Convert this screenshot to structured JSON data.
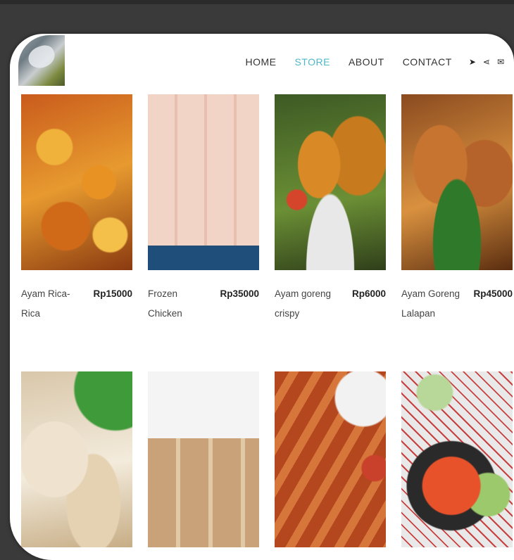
{
  "nav": {
    "items": [
      {
        "label": "HOME",
        "active": false
      },
      {
        "label": "STORE",
        "active": true
      },
      {
        "label": "ABOUT",
        "active": false
      },
      {
        "label": "CONTACT",
        "active": false
      }
    ],
    "icons": [
      "location-arrow-icon",
      "share-icon",
      "envelope-icon"
    ],
    "accent_color": "#4fb8c8"
  },
  "products": [
    {
      "name": "Ayam Rica-Rica",
      "price": "Rp15000"
    },
    {
      "name": "Frozen Chicken",
      "price": "Rp35000"
    },
    {
      "name": "Ayam goreng crispy",
      "price": "Rp6000"
    },
    {
      "name": "Ayam Goreng Lalapan",
      "price": "Rp45000"
    }
  ]
}
